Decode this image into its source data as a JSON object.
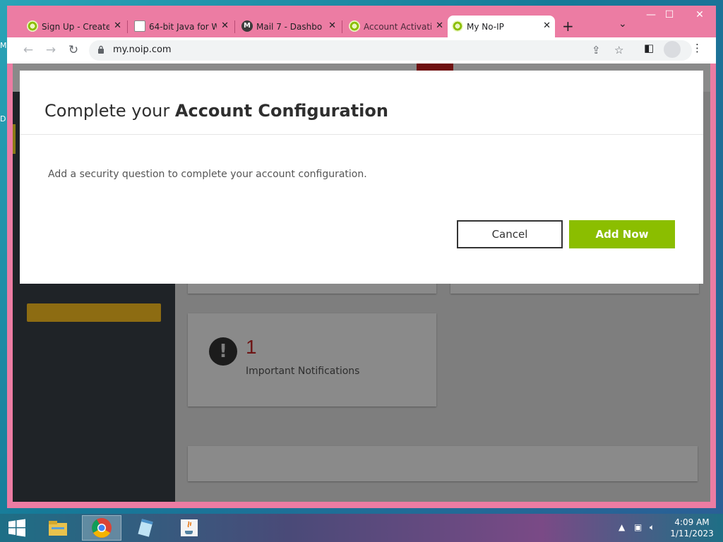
{
  "desktop": {
    "edge_labels": [
      "M",
      "D"
    ]
  },
  "browser": {
    "tabs": [
      {
        "title": "Sign Up - Create",
        "icon": "noip-icon",
        "active": false
      },
      {
        "title": "64-bit Java for W",
        "icon": "doc-icon",
        "active": false
      },
      {
        "title": "Mail 7 - Dashbo",
        "icon": "mail-m-icon",
        "active": false
      },
      {
        "title": "Account Activati",
        "icon": "noip-icon",
        "active": false
      },
      {
        "title": "My No-IP",
        "icon": "noip-icon",
        "active": true
      }
    ],
    "tab_close_glyph": "✕",
    "new_tab_glyph": "+",
    "url": "my.noip.com",
    "window_controls": {
      "minimize": "—",
      "maximize": "☐",
      "close": "✕"
    }
  },
  "page": {
    "notification": {
      "count": "1",
      "label": "Important Notifications",
      "icon_glyph": "!"
    }
  },
  "modal": {
    "title_prefix": "Complete your",
    "title_bold": "Account Configuration",
    "message": "Add a security question to complete your account configuration.",
    "cancel_label": "Cancel",
    "add_label": "Add Now",
    "accent_color": "#8bbe00"
  },
  "taskbar": {
    "time": "4:09 AM",
    "date": "1/11/2023",
    "items": [
      "file-explorer-icon",
      "chrome-icon",
      "notepad-icon",
      "java-icon"
    ]
  }
}
